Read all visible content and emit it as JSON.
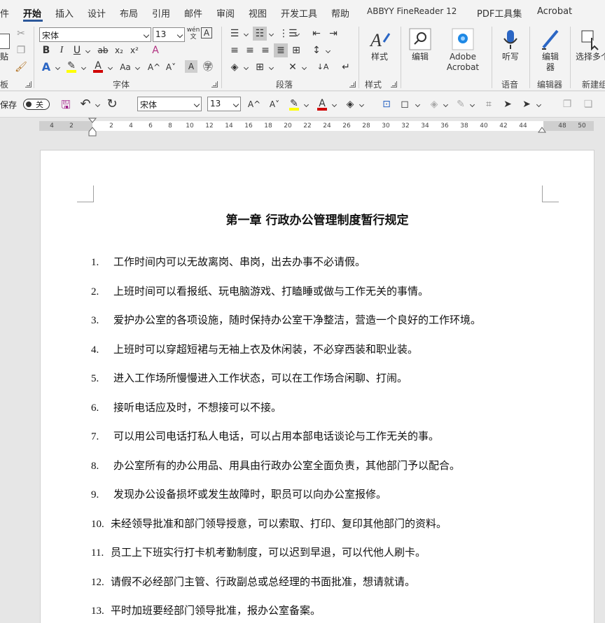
{
  "tabs": [
    "件",
    "开始",
    "插入",
    "设计",
    "布局",
    "引用",
    "邮件",
    "审阅",
    "视图",
    "开发工具",
    "帮助",
    "ABBYY FineReader 12",
    "PDF工具集",
    "Acrobat"
  ],
  "ribbon": {
    "font_name": "宋体",
    "font_size": "13",
    "paste_label": "贴",
    "clipboard_label": "板",
    "font_group_label": "字体",
    "paragraph_group_label": "段落",
    "styles_label": "样式",
    "styles_group_label": "样式",
    "edit_label": "编辑",
    "adobe_label": "Adobe Acrobat",
    "dictate_label": "听写",
    "voice_group_label": "语音",
    "editor_label": "编辑器",
    "editor_group_label": "编辑器",
    "select_label": "选择多个对象",
    "new_group_label": "新建组",
    "bold": "B",
    "italic": "I",
    "underline": "U",
    "strike": "ab",
    "subscript": "x₂",
    "superscript": "x²",
    "grow_font": "A^",
    "shrink_font": "A˅",
    "change_case": "Aa",
    "phonetic": "wén"
  },
  "qat": {
    "autosave_label": "保存",
    "autosave_state": "关",
    "font_name": "宋体",
    "font_size": "13"
  },
  "ruler": {
    "left_ticks": [
      "4",
      "2"
    ],
    "ticks": [
      "2",
      "4",
      "6",
      "8",
      "10",
      "12",
      "14",
      "16",
      "18",
      "20",
      "22",
      "24",
      "26",
      "28",
      "30",
      "32",
      "34",
      "36",
      "38",
      "40",
      "42",
      "44"
    ],
    "right_ticks": [
      "48",
      "50"
    ]
  },
  "document": {
    "title": "第一章 行政办公管理制度暂行规定",
    "items": [
      {
        "num": "1.",
        "text": "工作时间内可以无故离岗、串岗，出去办事不必请假。"
      },
      {
        "num": "2.",
        "text": "上班时间可以看报纸、玩电脑游戏、打瞌睡或做与工作无关的事情。"
      },
      {
        "num": "3.",
        "text": "爱护办公室的各项设施，随时保持办公室干净整洁，营造一个良好的工作环境。"
      },
      {
        "num": "4.",
        "text": "上班时可以穿超短裙与无袖上衣及休闲装，不必穿西装和职业装。"
      },
      {
        "num": "5.",
        "text": "进入工作场所慢慢进入工作状态，可以在工作场合闲聊、打闹。"
      },
      {
        "num": "6.",
        "text": "接听电话应及时，不想接可以不接。"
      },
      {
        "num": "7.",
        "text": "可以用公司电话打私人电话，可以占用本部电话谈论与工作无关的事。"
      },
      {
        "num": "8.",
        "text": "办公室所有的办公用品、用具由行政办公室全面负责，其他部门予以配合。"
      },
      {
        "num": "9.",
        "text": "发现办公设备损坏或发生故障时，职员可以向办公室报修。"
      },
      {
        "num": "10.",
        "text": "未经领导批准和部门领导授意，可以索取、打印、复印其他部门的资料。"
      },
      {
        "num": "11.",
        "text": "员工上下班实行打卡机考勤制度，可以迟到早退，可以代他人刷卡。"
      },
      {
        "num": "12.",
        "text": "请假不必经部门主管、行政副总或总经理的书面批准，想请就请。"
      },
      {
        "num": "13.",
        "text": "平时加班要经部门领导批准，报办公室备案。"
      }
    ]
  },
  "colors": {
    "accent": "#2b579a",
    "highlight": "#ffff00",
    "font_color": "#d00000"
  }
}
